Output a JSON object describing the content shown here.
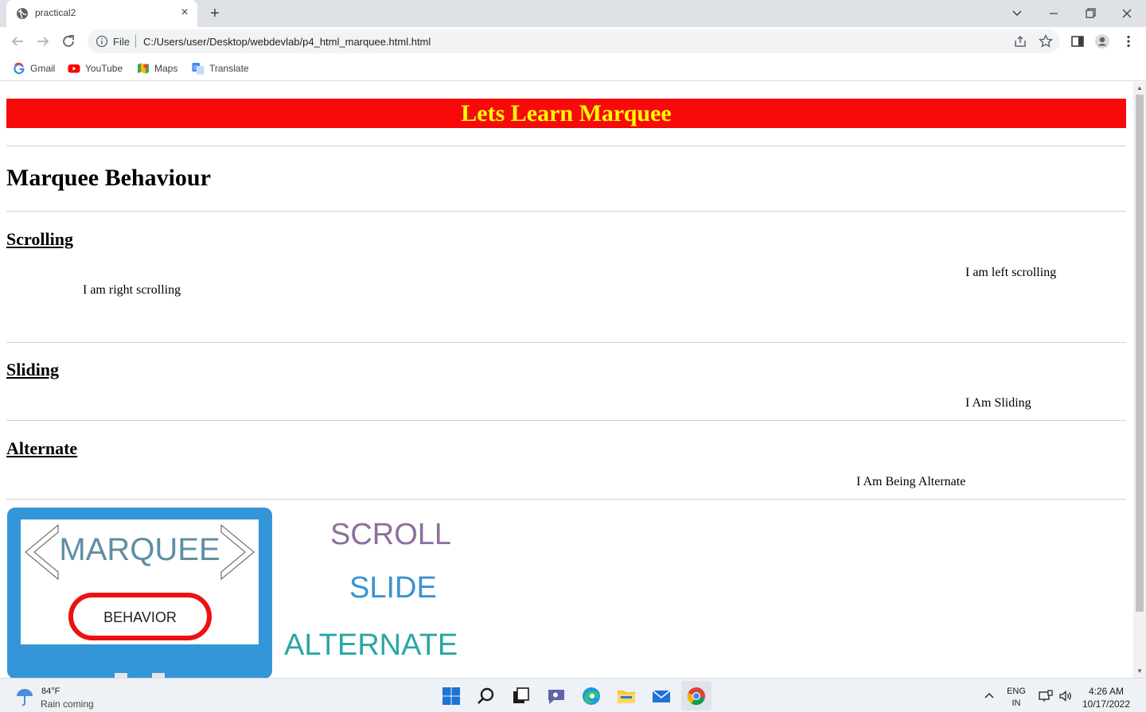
{
  "browser": {
    "tab_title": "practical2",
    "new_tab_label": "+",
    "omnibox_scheme": "File",
    "url": "C:/Users/user/Desktop/webdevlab/p4_html_marquee.html.html",
    "bookmarks": [
      {
        "label": "Gmail",
        "icon": "gmail-icon"
      },
      {
        "label": "YouTube",
        "icon": "youtube-icon"
      },
      {
        "label": "Maps",
        "icon": "maps-icon"
      },
      {
        "label": "Translate",
        "icon": "translate-icon"
      }
    ]
  },
  "page": {
    "banner_title": "Lets Learn Marquee",
    "banner_color": "#f70a0a",
    "banner_text_color": "#ffff00",
    "heading": "Marquee Behaviour",
    "sections": {
      "scrolling": {
        "title": "Scrolling",
        "left_text": "I am left scrolling",
        "right_text": "I am right scrolling"
      },
      "sliding": {
        "title": "Sliding",
        "text": "I Am Sliding"
      },
      "alternate": {
        "title": "Alternate",
        "text": "I Am Being Alternate"
      }
    },
    "logo": {
      "title": "MARQUEE",
      "badge": "BEHAVIOR",
      "frame_color": "#3496d8",
      "pill_color": "#ee1111"
    },
    "words": [
      {
        "text": "SCROLL",
        "color": "#8f6ea0"
      },
      {
        "text": "SLIDE",
        "color": "#3a93cf"
      },
      {
        "text": "ALTERNATE",
        "color": "#2aa6a6"
      }
    ]
  },
  "taskbar": {
    "weather_temp": "84°F",
    "weather_desc": "Rain coming",
    "language": "ENG",
    "region": "IN",
    "time": "4:26 AM",
    "date": "10/17/2022"
  }
}
